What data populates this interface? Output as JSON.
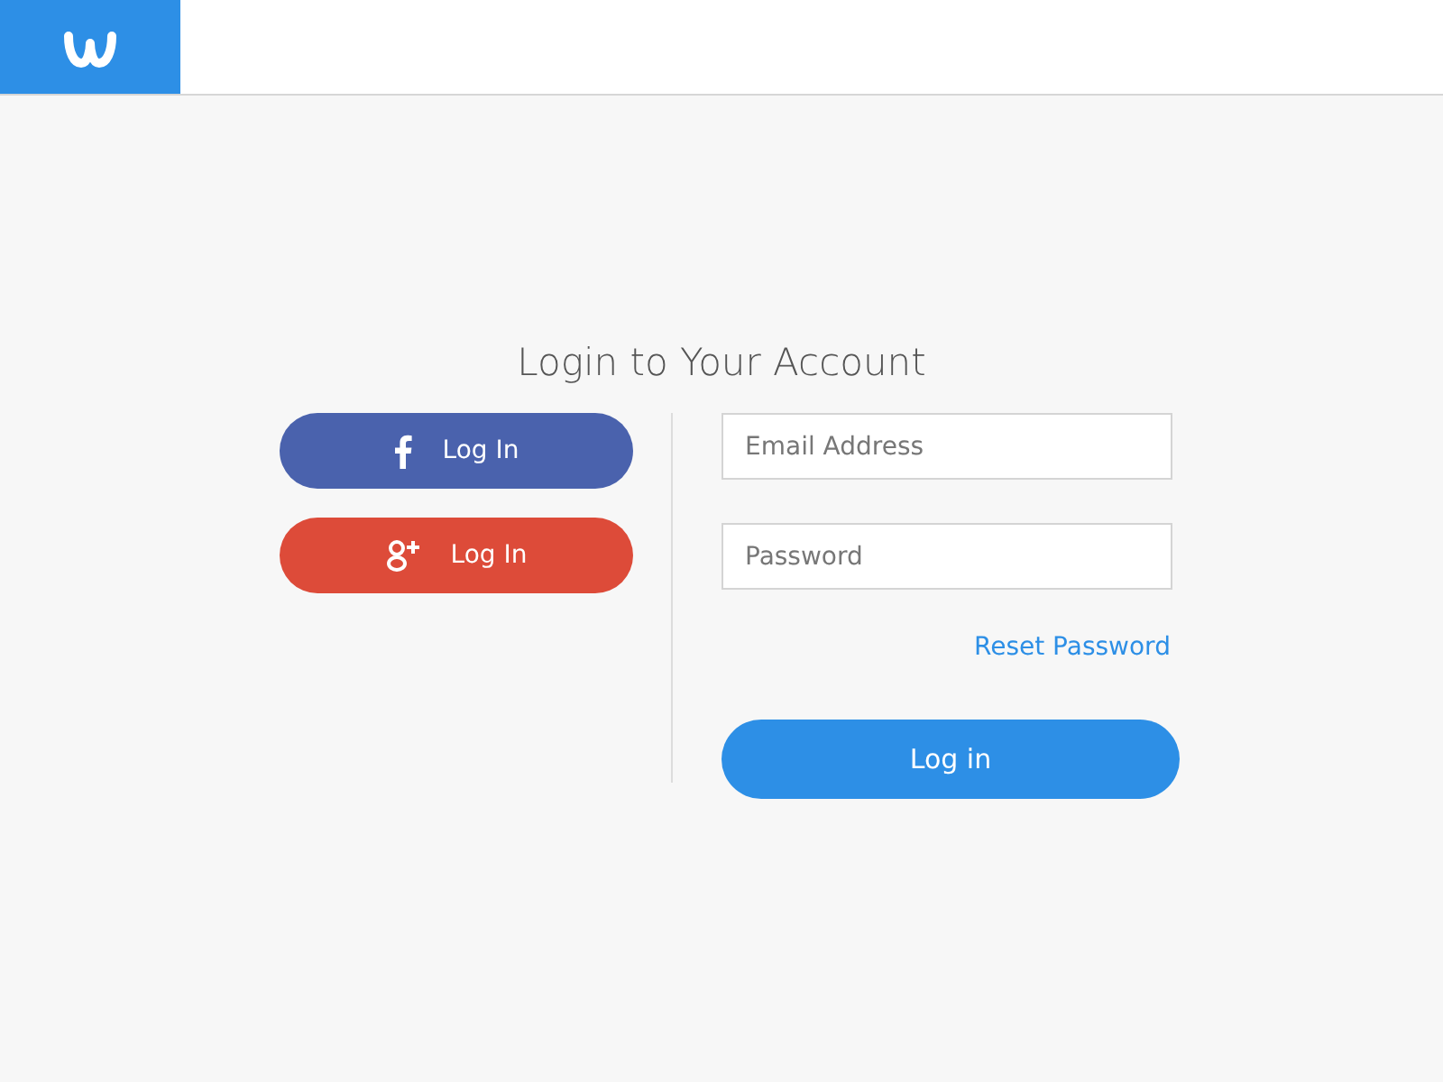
{
  "header": {
    "logo": {
      "kind": "w-mark"
    }
  },
  "title": "Login to Your Account",
  "social_buttons": [
    {
      "kind": "facebook",
      "label": "Log In"
    },
    {
      "kind": "google",
      "label": "Log In"
    }
  ],
  "fields": [
    {
      "kind": "email",
      "placeholder": "Email Address"
    },
    {
      "kind": "password",
      "placeholder": "Password"
    }
  ],
  "reset_link": "Reset Password",
  "submit_button": "Log in"
}
